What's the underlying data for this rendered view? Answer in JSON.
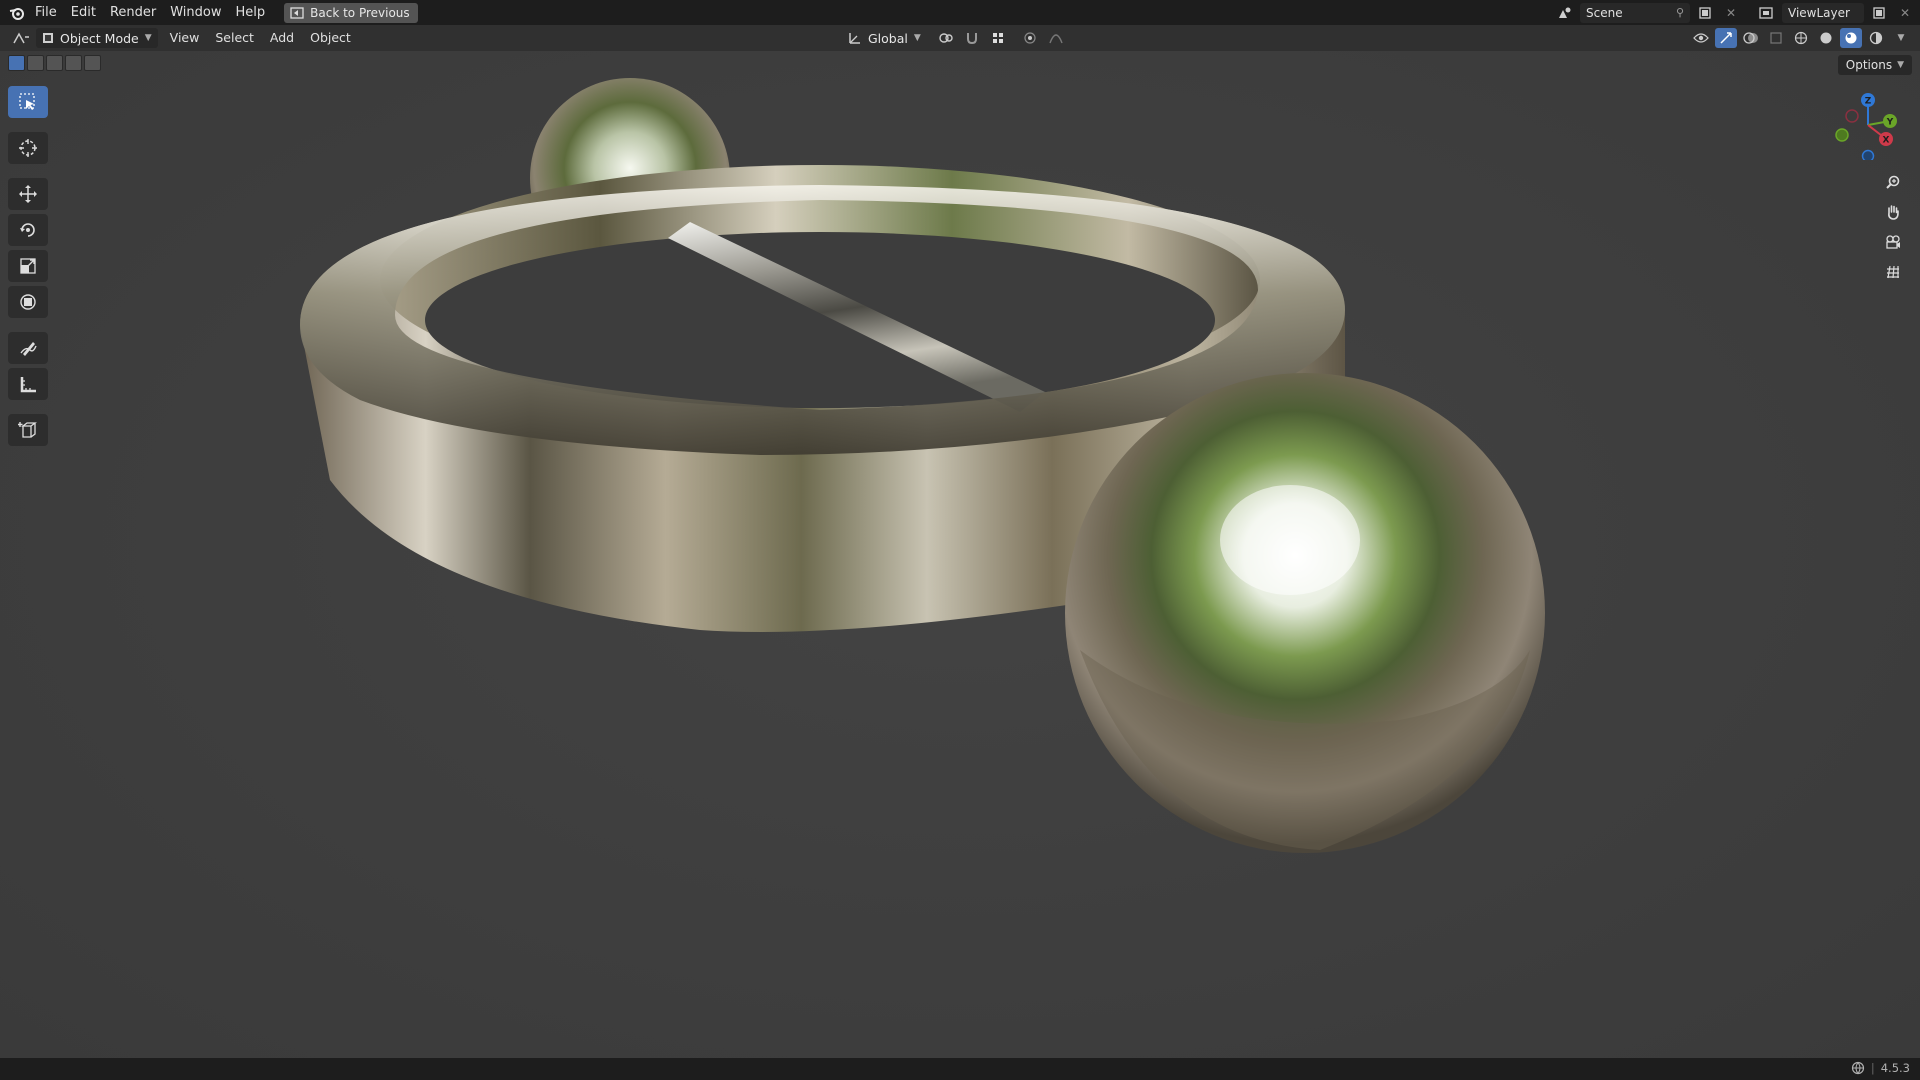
{
  "topbar": {
    "menu": [
      "File",
      "Edit",
      "Render",
      "Window",
      "Help"
    ],
    "back_button": "Back to Previous",
    "scene_name": "Scene",
    "view_layer": "ViewLayer"
  },
  "header": {
    "mode": "Object Mode",
    "menus": [
      "View",
      "Select",
      "Add",
      "Object"
    ],
    "transform_orientation": "Global"
  },
  "viewport": {
    "options_label": "Options",
    "gizmo_axes": [
      "Z",
      "Y",
      "X"
    ]
  },
  "toolbar": {
    "tools": [
      "select-box",
      "cursor",
      "move",
      "rotate",
      "scale",
      "transform",
      "annotate",
      "measure",
      "add-cube"
    ]
  },
  "status": {
    "version": "4.5.3"
  }
}
